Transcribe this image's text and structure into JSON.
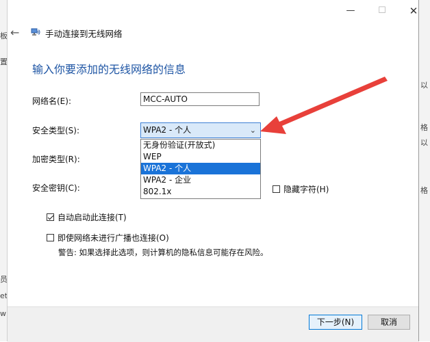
{
  "background": {
    "left_fragments": [
      "板",
      "置",
      "员",
      "et",
      "w"
    ],
    "right_fragments": [
      "以",
      "格",
      "以",
      "格"
    ]
  },
  "window": {
    "minimize_label": "—",
    "maximize_label": "☐",
    "close_label": "✕"
  },
  "header": {
    "back_label": "←",
    "title": "手动连接到无线网络"
  },
  "heading": "输入你要添加的无线网络的信息",
  "form": {
    "network_name_label": "网络名(E):",
    "network_name_value": "MCC-AUTO",
    "security_type_label": "安全类型(S):",
    "security_type_value": "WPA2 - 个人",
    "security_options": [
      "无身份验证(开放式)",
      "WEP",
      "WPA2 - 个人",
      "WPA2 - 企业",
      "802.1x"
    ],
    "selected_option_index": 2,
    "encryption_type_label": "加密类型(R):",
    "security_key_label": "安全密钥(C):",
    "hide_chars_label": "隐藏字符(H)",
    "hide_chars_checked": false,
    "auto_start_label": "自动启动此连接(T)",
    "auto_start_checked": true,
    "connect_hidden_label": "即使网络未进行广播也连接(O)",
    "connect_hidden_checked": false,
    "warning": "警告: 如果选择此选项，则计算机的隐私信息可能存在风险。"
  },
  "footer": {
    "next_label": "下一步(N)",
    "cancel_label": "取消"
  },
  "colors": {
    "heading": "#1e55a4",
    "selected_option": "#1a73d8",
    "arrow": "#e8403a"
  }
}
